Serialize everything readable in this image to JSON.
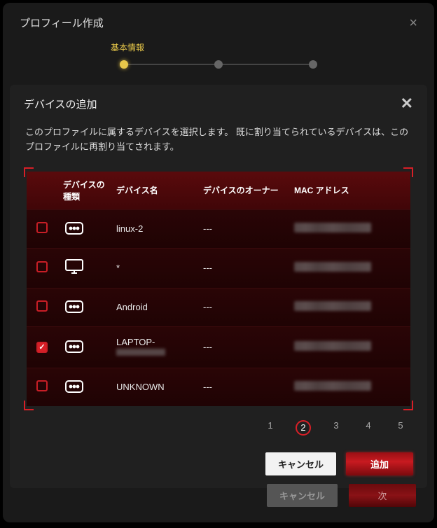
{
  "outer": {
    "title": "プロフィール作成",
    "stepLabel": "基本情報",
    "cancel": "キャンセル",
    "next": "次"
  },
  "modal": {
    "title": "デバイスの追加",
    "desc": "このプロファイルに属するデバイスを選択します。 既に割り当てられているデバイスは、このプロファイルに再割り当てされます。",
    "columns": {
      "type": "デバイスの種類",
      "name": "デバイス名",
      "owner": "デバイスのオーナー",
      "mac": "MAC アドレス"
    },
    "rows": [
      {
        "checked": false,
        "icon": "dots",
        "name": "linux-2",
        "owner": "---"
      },
      {
        "checked": false,
        "icon": "monitor",
        "name": "*",
        "owner": "---"
      },
      {
        "checked": false,
        "icon": "dots",
        "name": "Android",
        "owner": "---"
      },
      {
        "checked": true,
        "icon": "dots",
        "name": "LAPTOP-",
        "owner": "---"
      },
      {
        "checked": false,
        "icon": "dots",
        "name": "UNKNOWN",
        "owner": "---"
      }
    ],
    "pagination": {
      "pages": [
        "1",
        "2",
        "3",
        "4",
        "5"
      ],
      "active": 2
    },
    "cancel": "キャンセル",
    "add": "追加"
  }
}
